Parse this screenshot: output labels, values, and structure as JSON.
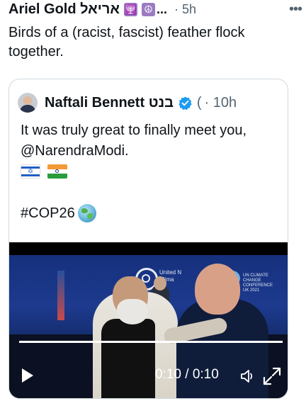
{
  "tweet": {
    "author_name": "Ariel Gold אריאל",
    "emoji_1": "🕎",
    "emoji_2": "☮",
    "ellipsis": "...",
    "time": "· 5h",
    "more_label": "•••",
    "text": "Birds of a (racist, fascist) feather flock together."
  },
  "quote": {
    "author_name": "Naftali Bennett בנט",
    "truncation": "(",
    "time": "· 10h",
    "text": "It was truly great to finally meet you, @NarendraModi.",
    "flags": [
      "israel-flag",
      "india-flag"
    ],
    "hashtag": "#COP26",
    "hashtag_emoji": "globe-icon",
    "video": {
      "backdrop_text_1": "United N",
      "backdrop_text_2": "Clima",
      "banner_text": "UN CLIMATE CHANGE CONFERENCE UK 2021",
      "time_readout": "0:10 / 0:10",
      "progress": 1.0
    }
  },
  "colors": {
    "text": "#0f1419",
    "muted": "#536471",
    "verified": "#1d9bf0",
    "border": "#cfd9de"
  }
}
